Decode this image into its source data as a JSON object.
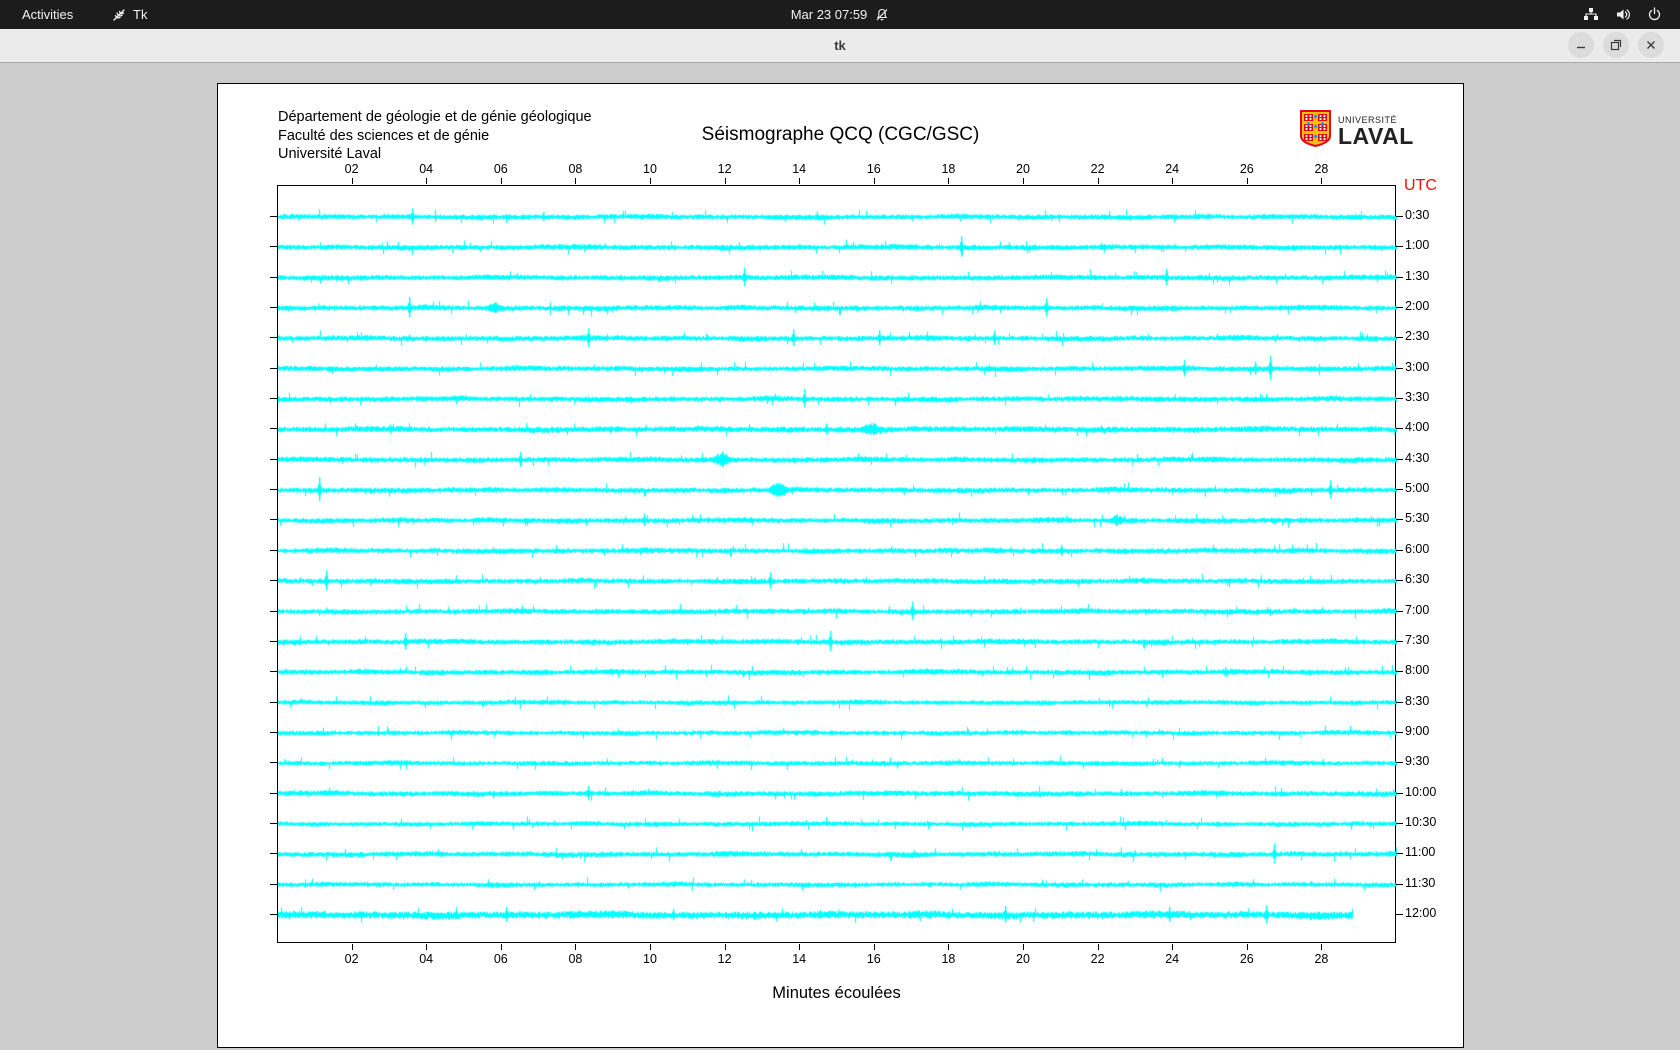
{
  "topbar": {
    "activities_label": "Activities",
    "app_label": "Tk",
    "clock": "Mar 23 07:59",
    "icons": [
      "tk-feather-icon",
      "notifications-muted-icon",
      "network-icon",
      "volume-icon",
      "power-icon"
    ]
  },
  "titlebar": {
    "title": "tk",
    "buttons": [
      "minimize",
      "restore",
      "close"
    ]
  },
  "window": {
    "header_line1": "Département de géologie et de génie géologique",
    "header_line2": "Faculté des sciences et de génie",
    "header_line3": "Université Laval",
    "plot_title": "Séismographe QCQ (CGC/GSC)",
    "logo_line1": "UNIVERSITÉ",
    "logo_line2": "LAVAL"
  },
  "colors": {
    "trace": "#00ffff",
    "utc_red": "#fb0a06",
    "topbar_bg": "#1c1c1c",
    "titlebar_bg": "#ebebeb",
    "desktop_bg": "#cdcdcd",
    "window_bg": "#ffffff",
    "axis_black": "#000000"
  },
  "chart_data": {
    "type": "line",
    "subtype": "seismogram-helicorder",
    "station": "QCQ (CGC/GSC)",
    "xlabel": "Minutes écoulées",
    "utc_label": "UTC",
    "x_axis_minutes": [
      0,
      30
    ],
    "x_tick_labels": [
      "02",
      "04",
      "06",
      "08",
      "10",
      "12",
      "14",
      "16",
      "18",
      "20",
      "22",
      "24",
      "26",
      "28"
    ],
    "minutes_per_row": 30,
    "rows": [
      {
        "label": "0:30",
        "end_min": 30,
        "gain": 1,
        "spikes": [
          {
            "m": 3.6,
            "a": 9
          },
          {
            "m": 7.1,
            "a": 5
          }
        ]
      },
      {
        "label": "1:00",
        "end_min": 30,
        "gain": 1,
        "spikes": [
          {
            "m": 18.3,
            "a": 11
          }
        ]
      },
      {
        "label": "1:30",
        "end_min": 30,
        "gain": 1,
        "spikes": [
          {
            "m": 12.5,
            "a": 10
          },
          {
            "m": 23.8,
            "a": 9
          }
        ]
      },
      {
        "label": "2:00",
        "end_min": 30,
        "gain": 1,
        "spikes": [
          {
            "m": 3.5,
            "a": 11
          },
          {
            "m": 5.8,
            "a": 4,
            "w": 12
          },
          {
            "m": 20.6,
            "a": 10
          }
        ]
      },
      {
        "label": "2:30",
        "end_min": 30,
        "gain": 1,
        "spikes": [
          {
            "m": 8.3,
            "a": 10
          },
          {
            "m": 13.8,
            "a": 9
          },
          {
            "m": 16.1,
            "a": 8
          },
          {
            "m": 19.2,
            "a": 8
          }
        ]
      },
      {
        "label": "3:00",
        "end_min": 30,
        "gain": 1,
        "spikes": [
          {
            "m": 24.3,
            "a": 9
          },
          {
            "m": 26.2,
            "a": 7
          },
          {
            "m": 26.6,
            "a": 13
          }
        ]
      },
      {
        "label": "3:30",
        "end_min": 30,
        "gain": 1,
        "spikes": [
          {
            "m": 14.1,
            "a": 10
          }
        ]
      },
      {
        "label": "4:00",
        "end_min": 30,
        "gain": 1.1,
        "spikes": [
          {
            "m": 3.0,
            "a": 5
          },
          {
            "m": 14.7,
            "a": 6
          },
          {
            "m": 15.9,
            "a": 5,
            "w": 14
          }
        ]
      },
      {
        "label": "4:30",
        "end_min": 30,
        "gain": 1,
        "spikes": [
          {
            "m": 6.5,
            "a": 8
          },
          {
            "m": 11.9,
            "a": 5,
            "w": 14
          }
        ]
      },
      {
        "label": "5:00",
        "end_min": 30,
        "gain": 1,
        "spikes": [
          {
            "m": 1.1,
            "a": 13
          },
          {
            "m": 13.4,
            "a": 5,
            "w": 14
          },
          {
            "m": 28.2,
            "a": 10
          }
        ]
      },
      {
        "label": "5:30",
        "end_min": 30,
        "gain": 1,
        "spikes": [
          {
            "m": 9.8,
            "a": 7
          },
          {
            "m": 22.5,
            "a": 4,
            "w": 12
          }
        ]
      },
      {
        "label": "6:00",
        "end_min": 30,
        "gain": 1,
        "spikes": [
          {
            "m": 21.0,
            "a": 6
          }
        ]
      },
      {
        "label": "6:30",
        "end_min": 30,
        "gain": 1,
        "spikes": [
          {
            "m": 1.3,
            "a": 11
          },
          {
            "m": 13.2,
            "a": 9
          }
        ]
      },
      {
        "label": "7:00",
        "end_min": 30,
        "gain": 1,
        "spikes": [
          {
            "m": 17.0,
            "a": 10
          }
        ]
      },
      {
        "label": "7:30",
        "end_min": 30,
        "gain": 1,
        "spikes": [
          {
            "m": 3.4,
            "a": 9
          },
          {
            "m": 14.8,
            "a": 11
          }
        ]
      },
      {
        "label": "8:00",
        "end_min": 30,
        "gain": 1,
        "spikes": [
          {
            "m": 25.4,
            "a": 5
          }
        ]
      },
      {
        "label": "8:30",
        "end_min": 30,
        "gain": 0.9,
        "spikes": []
      },
      {
        "label": "9:00",
        "end_min": 30,
        "gain": 0.9,
        "spikes": []
      },
      {
        "label": "9:30",
        "end_min": 30,
        "gain": 0.9,
        "spikes": []
      },
      {
        "label": "10:00",
        "end_min": 30,
        "gain": 1,
        "spikes": [
          {
            "m": 8.3,
            "a": 8
          }
        ]
      },
      {
        "label": "10:30",
        "end_min": 30,
        "gain": 0.9,
        "spikes": []
      },
      {
        "label": "11:00",
        "end_min": 30,
        "gain": 1,
        "spikes": [
          {
            "m": 26.7,
            "a": 11
          }
        ]
      },
      {
        "label": "11:30",
        "end_min": 30,
        "gain": 0.9,
        "spikes": []
      },
      {
        "label": "12:00",
        "end_min": 28.8,
        "gain": 1.4,
        "spikes": [
          {
            "m": 6.1,
            "a": 8
          },
          {
            "m": 10.6,
            "a": 6
          },
          {
            "m": 19.5,
            "a": 9
          },
          {
            "m": 23.9,
            "a": 8
          },
          {
            "m": 26.5,
            "a": 10
          }
        ]
      }
    ]
  }
}
